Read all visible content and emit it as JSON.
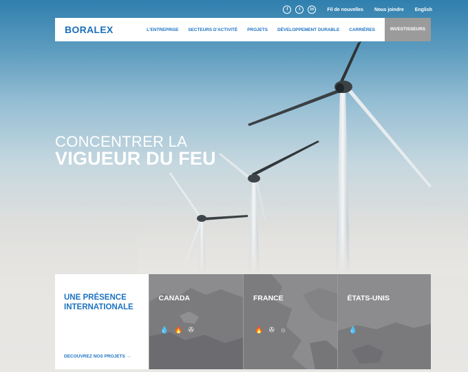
{
  "topbar": {
    "social": [
      "f",
      "t",
      "in"
    ],
    "links": [
      "Fil de nouvelles",
      "Nous joindre",
      "English"
    ]
  },
  "nav": {
    "logo": "BORALEX",
    "items": [
      "L'ENTREPRISE",
      "SECTEURS D'ACTIVITÉ",
      "PROJETS",
      "DÉVELOPPEMENT DURABLE",
      "CARRIÈRES"
    ],
    "invest": "INVESTISSEURS"
  },
  "hero": {
    "line1": "CONCENTRER LA",
    "line2": "VIGUEUR DU FEU"
  },
  "presence": {
    "title_line1": "UNE PRÉSENCE",
    "title_line2": "INTERNATIONALE",
    "link": "DECOUVREZ NOS PROJETS →",
    "countries": [
      {
        "name": "CANADA",
        "icons": [
          "💧",
          "🔥",
          "✇"
        ]
      },
      {
        "name": "FRANCE",
        "icons": [
          "🔥",
          "✇",
          "☼"
        ]
      },
      {
        "name": "ÉTATS-UNIS",
        "icons": [
          "💧"
        ]
      }
    ]
  }
}
